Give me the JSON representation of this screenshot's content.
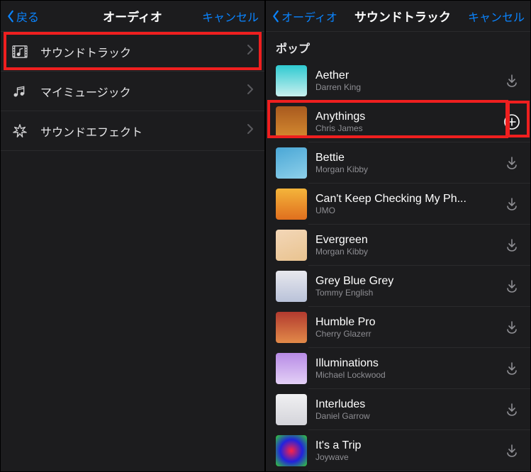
{
  "left": {
    "nav": {
      "back_label": "戻る",
      "title": "オーディオ",
      "cancel_label": "キャンセル"
    },
    "rows": [
      {
        "icon": "film-note",
        "label": "サウンドトラック"
      },
      {
        "icon": "music-note",
        "label": "マイミュージック"
      },
      {
        "icon": "sparkle",
        "label": "サウンドエフェクト"
      }
    ]
  },
  "right": {
    "nav": {
      "back_label": "オーディオ",
      "title": "サウンドトラック",
      "cancel_label": "キャンセル"
    },
    "section_header": "ポップ",
    "tracks": [
      {
        "title": "Aether",
        "artist": "Darren King",
        "action": "download"
      },
      {
        "title": "Anythings",
        "artist": "Chris James",
        "action": "add"
      },
      {
        "title": "Bettie",
        "artist": "Morgan Kibby",
        "action": "download"
      },
      {
        "title": "Can't Keep Checking My Ph...",
        "artist": "UMO",
        "action": "download"
      },
      {
        "title": "Evergreen",
        "artist": "Morgan Kibby",
        "action": "download"
      },
      {
        "title": "Grey Blue Grey",
        "artist": "Tommy English",
        "action": "download"
      },
      {
        "title": "Humble Pro",
        "artist": "Cherry Glazerr",
        "action": "download"
      },
      {
        "title": "Illuminations",
        "artist": "Michael Lockwood",
        "action": "download"
      },
      {
        "title": "Interludes",
        "artist": "Daniel Garrow",
        "action": "download"
      },
      {
        "title": "It's a Trip",
        "artist": "Joywave",
        "action": "download"
      }
    ]
  }
}
